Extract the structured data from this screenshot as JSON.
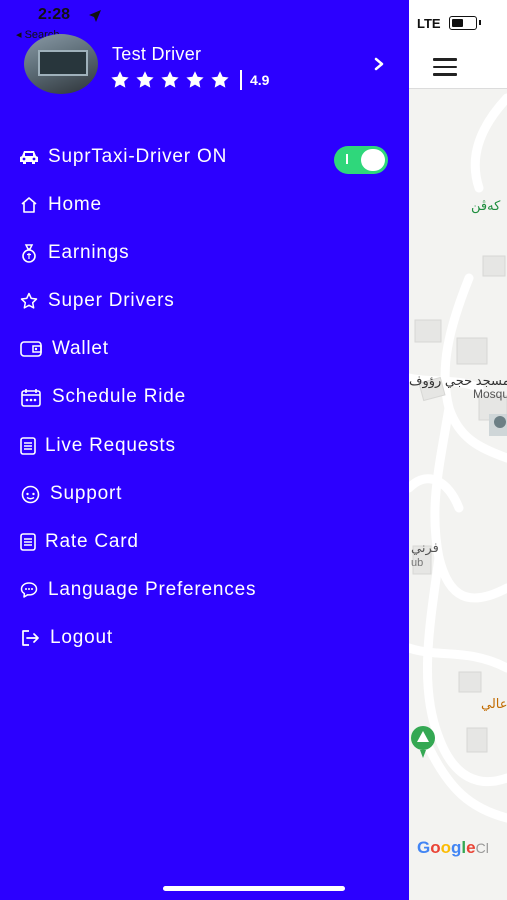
{
  "status": {
    "time": "2:28",
    "back_label": "◂ Search",
    "carrier": "LTE"
  },
  "profile": {
    "name": "Test Driver",
    "rating": "4.9",
    "stars": 5
  },
  "menu": {
    "toggle_item": "SuprTaxi-Driver ON",
    "toggle_on": true,
    "items": [
      {
        "label": "Home",
        "icon": "home-icon"
      },
      {
        "label": "Earnings",
        "icon": "money-bag-icon"
      },
      {
        "label": "Super Drivers",
        "icon": "star-icon"
      },
      {
        "label": "Wallet",
        "icon": "wallet-icon"
      },
      {
        "label": "Schedule Ride",
        "icon": "calendar-icon"
      },
      {
        "label": "Live Requests",
        "icon": "list-icon"
      },
      {
        "label": "Support",
        "icon": "support-icon"
      },
      {
        "label": "Rate Card",
        "icon": "list-icon"
      },
      {
        "label": "Language Preferences",
        "icon": "chat-bubble-icon"
      },
      {
        "label": "Logout",
        "icon": "logout-icon"
      }
    ]
  },
  "map": {
    "labels": [
      "كەڤن",
      "مسجد حجي رؤوف",
      "Mosqu",
      "فرني",
      "ub",
      "عالي"
    ],
    "attribution": "Google",
    "attribution_suffix": "Cl"
  },
  "colors": {
    "drawer": "#2c00ff",
    "toggle": "#2fd77b"
  }
}
